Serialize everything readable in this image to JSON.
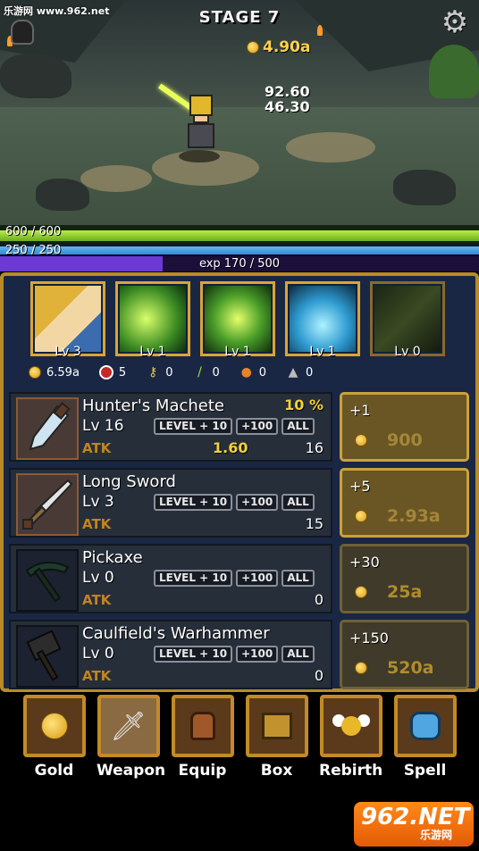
{
  "watermark": "乐游网 www.962.net",
  "stage": {
    "title": "STAGE 7",
    "gold": "4.90a"
  },
  "damage": [
    "92.60",
    "46.30"
  ],
  "bars": {
    "hp": {
      "text": "600 / 600",
      "fill_fraction": 1.0,
      "color": "#8cd030"
    },
    "mp": {
      "text": "250 / 250",
      "fill_fraction": 1.0,
      "color": "#3b8fde"
    },
    "exp": {
      "text": "exp 170 / 500",
      "fill_fraction": 0.34,
      "color": "#6b3ad6"
    }
  },
  "heroes": [
    {
      "level": "Lv 3",
      "icon": "knight-portrait-icon"
    },
    {
      "level": "Lv 1",
      "icon": "wind-slash-skill-icon"
    },
    {
      "level": "Lv 1",
      "icon": "leaf-storm-skill-icon"
    },
    {
      "level": "Lv 1",
      "icon": "water-wave-skill-icon"
    },
    {
      "level": "Lv 0",
      "icon": "locked-sword-skill-icon"
    }
  ],
  "stats": {
    "gold": "6.59a",
    "kills": "5",
    "keys": "0",
    "herbs": "0",
    "potions": "0",
    "rabbits": "0"
  },
  "weapon_buttons": {
    "level10": "LEVEL + 10",
    "plus100": "+100",
    "all": "ALL"
  },
  "atk_label": "ATK",
  "weapons": [
    {
      "name": "Hunter's Machete",
      "percent": "10 %",
      "level": "Lv 16",
      "atk_bonus": "1.60",
      "atk": "16",
      "upgrade": "+1",
      "cost": "900",
      "state": "active"
    },
    {
      "name": "Long Sword",
      "percent": "",
      "level": "Lv 3",
      "atk_bonus": "",
      "atk": "15",
      "upgrade": "+5",
      "cost": "2.93a",
      "state": "active"
    },
    {
      "name": "Pickaxe",
      "percent": "",
      "level": "Lv 0",
      "atk_bonus": "",
      "atk": "0",
      "upgrade": "+30",
      "cost": "25a",
      "state": "inactive"
    },
    {
      "name": "Caulfield's Warhammer",
      "percent": "",
      "level": "Lv 0",
      "atk_bonus": "",
      "atk": "0",
      "upgrade": "+150",
      "cost": "520a",
      "state": "inactive"
    }
  ],
  "nav": [
    {
      "label": "Gold",
      "icon": "gold-coin-icon"
    },
    {
      "label": "Weapon",
      "icon": "sword-icon",
      "active": true
    },
    {
      "label": "Equip",
      "icon": "backpack-icon"
    },
    {
      "label": "Box",
      "icon": "treasure-box-icon"
    },
    {
      "label": "Rebirth",
      "icon": "winged-orb-icon"
    },
    {
      "label": "Spell",
      "icon": "blue-spirit-icon"
    }
  ],
  "logo": {
    "main": "962.NET",
    "sub": "乐游网"
  }
}
